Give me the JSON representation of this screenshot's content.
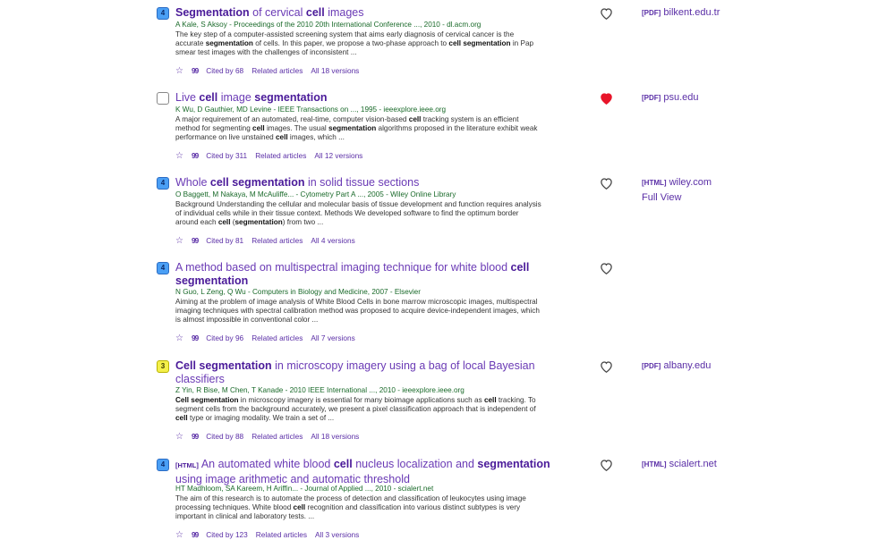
{
  "results": [
    {
      "badge": "4",
      "badge_color": "#4a9ff5",
      "title_parts": [
        [
          "Segmentation",
          true
        ],
        [
          " of cervical ",
          false
        ],
        [
          "cell",
          true
        ],
        [
          " images",
          false
        ]
      ],
      "title_prefix": "",
      "meta": "A Kale, S Aksoy - Proceedings of the 2010 20th International Conference ..., 2010 - dl.acm.org",
      "snippet_parts": [
        [
          "The key step of a computer-assisted screening system that aims early diagnosis of cervical cancer is the accurate ",
          false
        ],
        [
          "segmentation",
          true
        ],
        [
          " of cells. In this paper, we propose a two-phase approach to ",
          false
        ],
        [
          "cell segmentation",
          true
        ],
        [
          " in Pap smear test images with the challenges of inconsistent ...",
          false
        ]
      ],
      "cited_by": "Cited by 68",
      "related": "Related articles",
      "versions": "All 18 versions",
      "saved": false,
      "side_type": "[PDF]",
      "side_source": "bilkent.edu.tr",
      "side_extra": ""
    },
    {
      "badge": "",
      "badge_color": "#ffffff",
      "title_parts": [
        [
          "Live ",
          false
        ],
        [
          "cell",
          true
        ],
        [
          " image ",
          false
        ],
        [
          "segmentation",
          true
        ]
      ],
      "title_prefix": "",
      "meta": "K Wu, D Gauthier, MD Levine - IEEE Transactions on ..., 1995 - ieeexplore.ieee.org",
      "snippet_parts": [
        [
          "A major requirement of an automated, real-time, computer vision-based ",
          false
        ],
        [
          "cell",
          true
        ],
        [
          " tracking system is an efficient method for segmenting ",
          false
        ],
        [
          "cell",
          true
        ],
        [
          " images. The usual ",
          false
        ],
        [
          "segmentation",
          true
        ],
        [
          " algorithms proposed in the literature exhibit weak performance on live unstained ",
          false
        ],
        [
          "cell",
          true
        ],
        [
          " images, which ...",
          false
        ]
      ],
      "cited_by": "Cited by 311",
      "related": "Related articles",
      "versions": "All 12 versions",
      "saved": true,
      "side_type": "[PDF]",
      "side_source": "psu.edu",
      "side_extra": ""
    },
    {
      "badge": "4",
      "badge_color": "#4a9ff5",
      "title_parts": [
        [
          "Whole ",
          false
        ],
        [
          "cell segmentation",
          true
        ],
        [
          " in solid tissue sections",
          false
        ]
      ],
      "title_prefix": "",
      "meta": "O Baggett, M Nakaya, M McAuliffe... - Cytometry Part A ..., 2005 - Wiley Online Library",
      "snippet_parts": [
        [
          "Background Understanding the cellular and molecular basis of tissue development and function requires analysis of individual cells while in their tissue context. Methods We developed software to find the optimum border around each ",
          false
        ],
        [
          "cell",
          true
        ],
        [
          " (",
          false
        ],
        [
          "segmentation",
          true
        ],
        [
          ") from two ...",
          false
        ]
      ],
      "cited_by": "Cited by 81",
      "related": "Related articles",
      "versions": "All 4 versions",
      "saved": false,
      "side_type": "[HTML]",
      "side_source": "wiley.com",
      "side_extra": "Full View"
    },
    {
      "badge": "4",
      "badge_color": "#4a9ff5",
      "title_parts": [
        [
          "A method based on multispectral imaging technique for white blood ",
          false
        ],
        [
          "cell segmentation",
          true
        ]
      ],
      "title_prefix": "",
      "meta": "N Guo, L Zeng, Q Wu - Computers in Biology and Medicine, 2007 - Elsevier",
      "snippet_parts": [
        [
          "Aiming at the problem of image analysis of White Blood Cells in bone marrow microscopic images, multispectral imaging techniques with spectral calibration method was proposed to acquire device-independent images, which is almost impossible in conventional color ...",
          false
        ]
      ],
      "cited_by": "Cited by 96",
      "related": "Related articles",
      "versions": "All 7 versions",
      "saved": false,
      "side_type": "",
      "side_source": "",
      "side_extra": ""
    },
    {
      "badge": "3",
      "badge_color": "#f4f04a",
      "title_parts": [
        [
          "Cell segmentation",
          true
        ],
        [
          " in microscopy imagery using a bag of local Bayesian classifiers",
          false
        ]
      ],
      "title_prefix": "",
      "meta": "Z Yin, R Bise, M Chen, T Kanade - 2010 IEEE International ..., 2010 - ieeexplore.ieee.org",
      "snippet_parts": [
        [
          "Cell segmentation",
          true
        ],
        [
          " in microscopy imagery is essential for many bioimage applications such as ",
          false
        ],
        [
          "cell",
          true
        ],
        [
          " tracking. To segment cells from the background accurately, we present a pixel classification approach that is independent of ",
          false
        ],
        [
          "cell",
          true
        ],
        [
          " type or imaging modality. We train a set of ...",
          false
        ]
      ],
      "cited_by": "Cited by 88",
      "related": "Related articles",
      "versions": "All 18 versions",
      "saved": false,
      "side_type": "[PDF]",
      "side_source": "albany.edu",
      "side_extra": ""
    },
    {
      "badge": "4",
      "badge_color": "#4a9ff5",
      "title_parts": [
        [
          "An automated white blood ",
          false
        ],
        [
          "cell",
          true
        ],
        [
          " nucleus localization and ",
          false
        ],
        [
          "segmentation",
          true
        ],
        [
          " using image arithmetic and automatic threshold",
          false
        ]
      ],
      "title_prefix": "[HTML]",
      "meta": "HT Madhloom, SA Kareem, H Ariffin... - Journal of Applied ..., 2010 - scialert.net",
      "snippet_parts": [
        [
          "The aim of this research is to automate the process of detection and classification of leukocytes using image processing techniques. White blood ",
          false
        ],
        [
          "cell",
          true
        ],
        [
          " recognition and classification into various distinct subtypes is very important in clinical and laboratory tests. ...",
          false
        ]
      ],
      "cited_by": "Cited by 123",
      "related": "Related articles",
      "versions": "All 3 versions",
      "saved": false,
      "side_type": "[HTML]",
      "side_source": "scialert.net",
      "side_extra": ""
    }
  ],
  "icons": {
    "star": "☆",
    "quote": "99",
    "heart_empty": "heart-outline-icon",
    "heart_filled": "heart-filled-icon",
    "saved_color": "#e8152a"
  }
}
